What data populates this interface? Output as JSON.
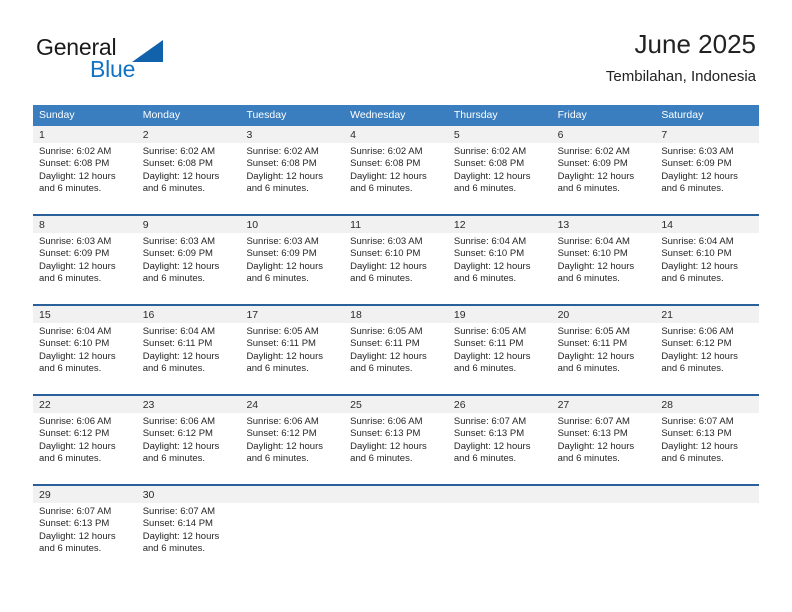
{
  "branding": {
    "logo_text_primary": "General",
    "logo_text_secondary": "Blue",
    "logo_triangle_color": "#1261ab",
    "secondary_color": "#1273c4"
  },
  "header": {
    "title": "June 2025",
    "subtitle": "Tembilahan, Indonesia"
  },
  "theme": {
    "header_row_bg": "#3a7ebf",
    "week_divider": "#2a6099",
    "daynum_bg": "#f1f1f1",
    "text": "#262626"
  },
  "calendar": {
    "weekday_headers": [
      "Sunday",
      "Monday",
      "Tuesday",
      "Wednesday",
      "Thursday",
      "Friday",
      "Saturday"
    ],
    "weeks": [
      {
        "days": [
          {
            "date": "1",
            "sunrise": "Sunrise: 6:02 AM",
            "sunset": "Sunset: 6:08 PM",
            "daylight_line1": "Daylight: 12 hours",
            "daylight_line2": "and 6 minutes."
          },
          {
            "date": "2",
            "sunrise": "Sunrise: 6:02 AM",
            "sunset": "Sunset: 6:08 PM",
            "daylight_line1": "Daylight: 12 hours",
            "daylight_line2": "and 6 minutes."
          },
          {
            "date": "3",
            "sunrise": "Sunrise: 6:02 AM",
            "sunset": "Sunset: 6:08 PM",
            "daylight_line1": "Daylight: 12 hours",
            "daylight_line2": "and 6 minutes."
          },
          {
            "date": "4",
            "sunrise": "Sunrise: 6:02 AM",
            "sunset": "Sunset: 6:08 PM",
            "daylight_line1": "Daylight: 12 hours",
            "daylight_line2": "and 6 minutes."
          },
          {
            "date": "5",
            "sunrise": "Sunrise: 6:02 AM",
            "sunset": "Sunset: 6:08 PM",
            "daylight_line1": "Daylight: 12 hours",
            "daylight_line2": "and 6 minutes."
          },
          {
            "date": "6",
            "sunrise": "Sunrise: 6:02 AM",
            "sunset": "Sunset: 6:09 PM",
            "daylight_line1": "Daylight: 12 hours",
            "daylight_line2": "and 6 minutes."
          },
          {
            "date": "7",
            "sunrise": "Sunrise: 6:03 AM",
            "sunset": "Sunset: 6:09 PM",
            "daylight_line1": "Daylight: 12 hours",
            "daylight_line2": "and 6 minutes."
          }
        ]
      },
      {
        "days": [
          {
            "date": "8",
            "sunrise": "Sunrise: 6:03 AM",
            "sunset": "Sunset: 6:09 PM",
            "daylight_line1": "Daylight: 12 hours",
            "daylight_line2": "and 6 minutes."
          },
          {
            "date": "9",
            "sunrise": "Sunrise: 6:03 AM",
            "sunset": "Sunset: 6:09 PM",
            "daylight_line1": "Daylight: 12 hours",
            "daylight_line2": "and 6 minutes."
          },
          {
            "date": "10",
            "sunrise": "Sunrise: 6:03 AM",
            "sunset": "Sunset: 6:09 PM",
            "daylight_line1": "Daylight: 12 hours",
            "daylight_line2": "and 6 minutes."
          },
          {
            "date": "11",
            "sunrise": "Sunrise: 6:03 AM",
            "sunset": "Sunset: 6:10 PM",
            "daylight_line1": "Daylight: 12 hours",
            "daylight_line2": "and 6 minutes."
          },
          {
            "date": "12",
            "sunrise": "Sunrise: 6:04 AM",
            "sunset": "Sunset: 6:10 PM",
            "daylight_line1": "Daylight: 12 hours",
            "daylight_line2": "and 6 minutes."
          },
          {
            "date": "13",
            "sunrise": "Sunrise: 6:04 AM",
            "sunset": "Sunset: 6:10 PM",
            "daylight_line1": "Daylight: 12 hours",
            "daylight_line2": "and 6 minutes."
          },
          {
            "date": "14",
            "sunrise": "Sunrise: 6:04 AM",
            "sunset": "Sunset: 6:10 PM",
            "daylight_line1": "Daylight: 12 hours",
            "daylight_line2": "and 6 minutes."
          }
        ]
      },
      {
        "days": [
          {
            "date": "15",
            "sunrise": "Sunrise: 6:04 AM",
            "sunset": "Sunset: 6:10 PM",
            "daylight_line1": "Daylight: 12 hours",
            "daylight_line2": "and 6 minutes."
          },
          {
            "date": "16",
            "sunrise": "Sunrise: 6:04 AM",
            "sunset": "Sunset: 6:11 PM",
            "daylight_line1": "Daylight: 12 hours",
            "daylight_line2": "and 6 minutes."
          },
          {
            "date": "17",
            "sunrise": "Sunrise: 6:05 AM",
            "sunset": "Sunset: 6:11 PM",
            "daylight_line1": "Daylight: 12 hours",
            "daylight_line2": "and 6 minutes."
          },
          {
            "date": "18",
            "sunrise": "Sunrise: 6:05 AM",
            "sunset": "Sunset: 6:11 PM",
            "daylight_line1": "Daylight: 12 hours",
            "daylight_line2": "and 6 minutes."
          },
          {
            "date": "19",
            "sunrise": "Sunrise: 6:05 AM",
            "sunset": "Sunset: 6:11 PM",
            "daylight_line1": "Daylight: 12 hours",
            "daylight_line2": "and 6 minutes."
          },
          {
            "date": "20",
            "sunrise": "Sunrise: 6:05 AM",
            "sunset": "Sunset: 6:11 PM",
            "daylight_line1": "Daylight: 12 hours",
            "daylight_line2": "and 6 minutes."
          },
          {
            "date": "21",
            "sunrise": "Sunrise: 6:06 AM",
            "sunset": "Sunset: 6:12 PM",
            "daylight_line1": "Daylight: 12 hours",
            "daylight_line2": "and 6 minutes."
          }
        ]
      },
      {
        "days": [
          {
            "date": "22",
            "sunrise": "Sunrise: 6:06 AM",
            "sunset": "Sunset: 6:12 PM",
            "daylight_line1": "Daylight: 12 hours",
            "daylight_line2": "and 6 minutes."
          },
          {
            "date": "23",
            "sunrise": "Sunrise: 6:06 AM",
            "sunset": "Sunset: 6:12 PM",
            "daylight_line1": "Daylight: 12 hours",
            "daylight_line2": "and 6 minutes."
          },
          {
            "date": "24",
            "sunrise": "Sunrise: 6:06 AM",
            "sunset": "Sunset: 6:12 PM",
            "daylight_line1": "Daylight: 12 hours",
            "daylight_line2": "and 6 minutes."
          },
          {
            "date": "25",
            "sunrise": "Sunrise: 6:06 AM",
            "sunset": "Sunset: 6:13 PM",
            "daylight_line1": "Daylight: 12 hours",
            "daylight_line2": "and 6 minutes."
          },
          {
            "date": "26",
            "sunrise": "Sunrise: 6:07 AM",
            "sunset": "Sunset: 6:13 PM",
            "daylight_line1": "Daylight: 12 hours",
            "daylight_line2": "and 6 minutes."
          },
          {
            "date": "27",
            "sunrise": "Sunrise: 6:07 AM",
            "sunset": "Sunset: 6:13 PM",
            "daylight_line1": "Daylight: 12 hours",
            "daylight_line2": "and 6 minutes."
          },
          {
            "date": "28",
            "sunrise": "Sunrise: 6:07 AM",
            "sunset": "Sunset: 6:13 PM",
            "daylight_line1": "Daylight: 12 hours",
            "daylight_line2": "and 6 minutes."
          }
        ]
      },
      {
        "days": [
          {
            "date": "29",
            "sunrise": "Sunrise: 6:07 AM",
            "sunset": "Sunset: 6:13 PM",
            "daylight_line1": "Daylight: 12 hours",
            "daylight_line2": "and 6 minutes."
          },
          {
            "date": "30",
            "sunrise": "Sunrise: 6:07 AM",
            "sunset": "Sunset: 6:14 PM",
            "daylight_line1": "Daylight: 12 hours",
            "daylight_line2": "and 6 minutes."
          },
          {
            "date": "",
            "sunrise": "",
            "sunset": "",
            "daylight_line1": "",
            "daylight_line2": ""
          },
          {
            "date": "",
            "sunrise": "",
            "sunset": "",
            "daylight_line1": "",
            "daylight_line2": ""
          },
          {
            "date": "",
            "sunrise": "",
            "sunset": "",
            "daylight_line1": "",
            "daylight_line2": ""
          },
          {
            "date": "",
            "sunrise": "",
            "sunset": "",
            "daylight_line1": "",
            "daylight_line2": ""
          },
          {
            "date": "",
            "sunrise": "",
            "sunset": "",
            "daylight_line1": "",
            "daylight_line2": ""
          }
        ]
      }
    ]
  }
}
